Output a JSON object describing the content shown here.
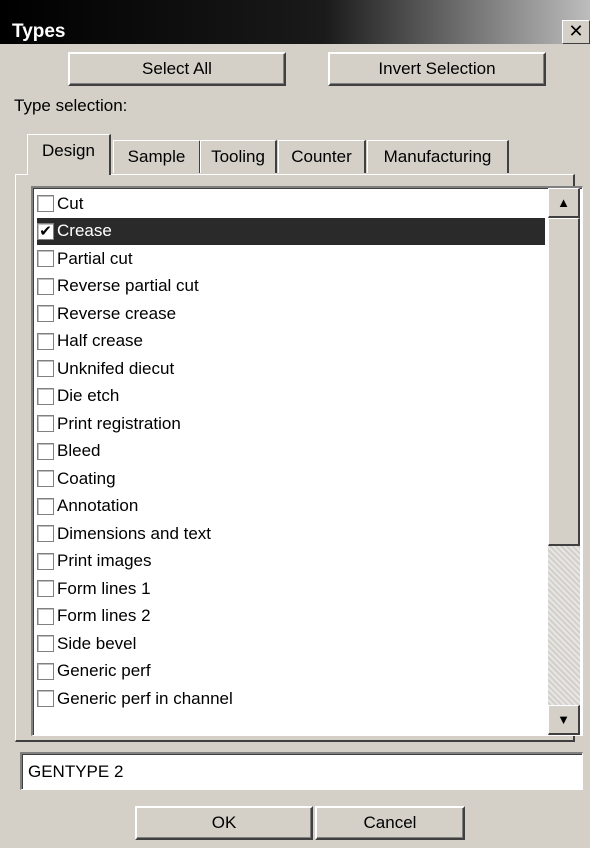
{
  "window": {
    "title": "Types",
    "close_glyph": "✕"
  },
  "buttons": {
    "select_all": "Select All",
    "invert_selection": "Invert Selection",
    "ok": "OK",
    "cancel": "Cancel"
  },
  "type_selection_label": "Type selection:",
  "tabs": [
    {
      "label": "Design",
      "active": true
    },
    {
      "label": "Sample",
      "active": false
    },
    {
      "label": "Tooling",
      "active": false
    },
    {
      "label": "Counter",
      "active": false
    },
    {
      "label": "Manufacturing",
      "active": false
    }
  ],
  "list_items": [
    {
      "label": "Cut",
      "checked": false,
      "selected": false
    },
    {
      "label": "Crease",
      "checked": true,
      "selected": true
    },
    {
      "label": "Partial cut",
      "checked": false,
      "selected": false
    },
    {
      "label": "Reverse partial cut",
      "checked": false,
      "selected": false
    },
    {
      "label": "Reverse crease",
      "checked": false,
      "selected": false
    },
    {
      "label": "Half crease",
      "checked": false,
      "selected": false
    },
    {
      "label": "Unknifed diecut",
      "checked": false,
      "selected": false
    },
    {
      "label": "Die etch",
      "checked": false,
      "selected": false
    },
    {
      "label": "Print registration",
      "checked": false,
      "selected": false
    },
    {
      "label": "Bleed",
      "checked": false,
      "selected": false
    },
    {
      "label": "Coating",
      "checked": false,
      "selected": false
    },
    {
      "label": "Annotation",
      "checked": false,
      "selected": false
    },
    {
      "label": "Dimensions and text",
      "checked": false,
      "selected": false
    },
    {
      "label": "Print images",
      "checked": false,
      "selected": false
    },
    {
      "label": "Form lines 1",
      "checked": false,
      "selected": false
    },
    {
      "label": "Form lines 2",
      "checked": false,
      "selected": false
    },
    {
      "label": "Side bevel",
      "checked": false,
      "selected": false
    },
    {
      "label": "Generic perf",
      "checked": false,
      "selected": false
    },
    {
      "label": "Generic perf in channel",
      "checked": false,
      "selected": false
    }
  ],
  "scrollbar": {
    "up_glyph": "▲",
    "down_glyph": "▼"
  },
  "name_field": {
    "value": "GENTYPE 2"
  }
}
